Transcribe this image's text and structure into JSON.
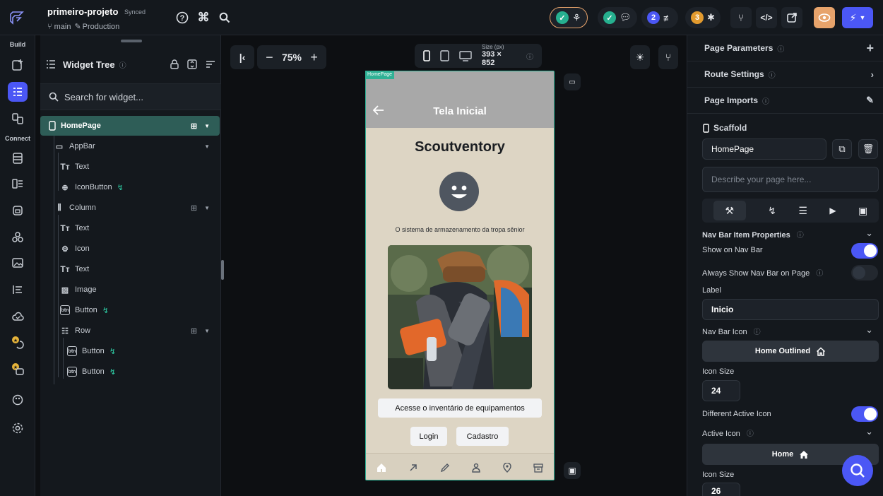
{
  "project": {
    "name": "primeiro-projeto",
    "status": "Synced",
    "branch": "main",
    "environment": "Production"
  },
  "toolbar": {
    "issues_count": "2",
    "bugs_count": "3",
    "accent": "#4b57f5",
    "active_view_color": "#e7a36b"
  },
  "rail": {
    "build_label": "Build",
    "connect_label": "Connect"
  },
  "widget_tree": {
    "title": "Widget Tree",
    "search_placeholder": "Search for widget...",
    "root": "HomePage",
    "nodes": [
      {
        "label": "AppBar"
      },
      {
        "label": "Text"
      },
      {
        "label": "IconButton"
      },
      {
        "label": "Column"
      },
      {
        "label": "Text"
      },
      {
        "label": "Icon"
      },
      {
        "label": "Text"
      },
      {
        "label": "Image"
      },
      {
        "label": "Button"
      },
      {
        "label": "Row"
      },
      {
        "label": "Button"
      },
      {
        "label": "Button"
      }
    ]
  },
  "canvas": {
    "zoom": "75%",
    "size_label": "Size (px)",
    "size_value": "393 × 852"
  },
  "phone": {
    "page_tag": "HomePage",
    "appbar_title": "Tela Inicial",
    "title": "Scoutventory",
    "subtitle": "O sistema de armazenamento da tropa sênior",
    "inventory_button": "Acesse o inventário de equipamentos",
    "login_button": "Login",
    "signup_button": "Cadastro"
  },
  "properties": {
    "page_parameters": "Page Parameters",
    "route_settings": "Route Settings",
    "page_imports": "Page Imports",
    "scaffold": "Scaffold",
    "page_name": "HomePage",
    "description_placeholder": "Describe your page here...",
    "nav_section": "Nav Bar Item Properties",
    "show_on_nav": "Show on Nav Bar",
    "always_show_nav": "Always Show Nav Bar on Page",
    "label_title": "Label",
    "label_value": "Inicio",
    "nav_icon_title": "Nav Bar Icon",
    "nav_icon_value": "Home Outlined",
    "icon_size_title": "Icon Size",
    "icon_size_value": "24",
    "different_active_icon": "Different Active Icon",
    "active_icon_title": "Active Icon",
    "active_icon_value": "Home",
    "icon_size2_title": "Icon Size",
    "icon_size2_value": "26"
  }
}
